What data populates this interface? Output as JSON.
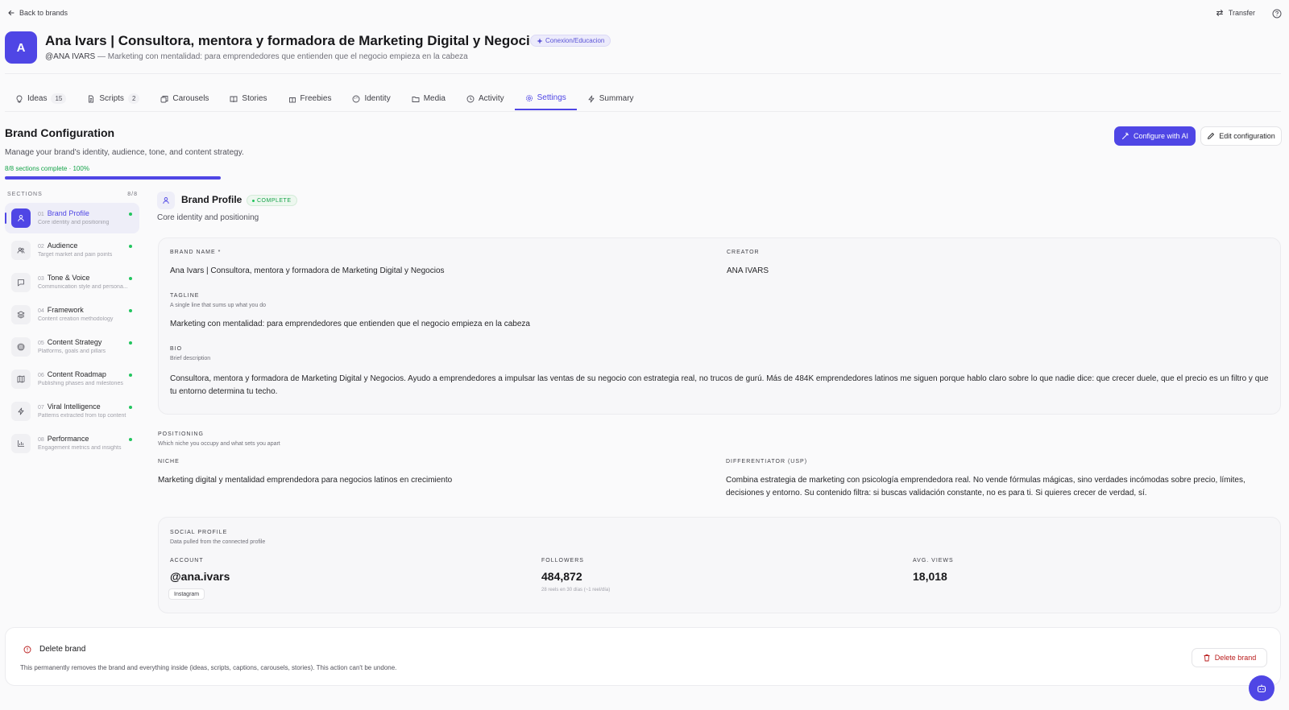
{
  "topbar": {
    "back_label": "Back to brands",
    "transfer_label": "Transfer"
  },
  "brand": {
    "avatar_letter": "A",
    "title": "Ana Ivars | Consultora, mentora y formadora de Marketing Digital y Negocios",
    "category": "Conexion/Educacion",
    "handle": "@ANA IVARS",
    "tagline_suffix": "— Marketing con mentalidad: para emprendedores que entienden que el negocio empieza en la cabeza"
  },
  "tabs": [
    {
      "label": "Ideas",
      "count": "15",
      "icon": "lightbulb-icon"
    },
    {
      "label": "Scripts",
      "count": "2",
      "icon": "document-icon"
    },
    {
      "label": "Carousels",
      "icon": "carousel-icon"
    },
    {
      "label": "Stories",
      "icon": "book-icon"
    },
    {
      "label": "Freebies",
      "icon": "gift-icon"
    },
    {
      "label": "Identity",
      "icon": "palette-icon"
    },
    {
      "label": "Media",
      "icon": "folder-icon"
    },
    {
      "label": "Activity",
      "icon": "clock-icon"
    },
    {
      "label": "Settings",
      "icon": "gear-icon",
      "active": true
    },
    {
      "label": "Summary",
      "icon": "bolt-icon"
    }
  ],
  "config": {
    "title": "Brand Configuration",
    "subtitle": "Manage your brand's identity, audience, tone, and content strategy.",
    "progress_text": "8/8 sections complete · 100%",
    "progress_fraction": 1.0,
    "configure_ai_label": "Configure with AI",
    "edit_label": "Edit configuration"
  },
  "sections": {
    "header": "SECTIONS",
    "count": "8/8",
    "items": [
      {
        "num": "01",
        "name": "Brand Profile",
        "desc": "Core identity and positioning",
        "icon": "user-icon",
        "active": true
      },
      {
        "num": "02",
        "name": "Audience",
        "desc": "Target market and pain points",
        "icon": "users-icon"
      },
      {
        "num": "03",
        "name": "Tone & Voice",
        "desc": "Communication style and persona...",
        "icon": "chat-icon"
      },
      {
        "num": "04",
        "name": "Framework",
        "desc": "Content creation methodology",
        "icon": "layers-icon"
      },
      {
        "num": "05",
        "name": "Content Strategy",
        "desc": "Platforms, goals and pillars",
        "icon": "target-icon"
      },
      {
        "num": "06",
        "name": "Content Roadmap",
        "desc": "Publishing phases and milestones",
        "icon": "map-icon"
      },
      {
        "num": "07",
        "name": "Viral Intelligence",
        "desc": "Patterns extracted from top content",
        "icon": "bolt-icon"
      },
      {
        "num": "08",
        "name": "Performance",
        "desc": "Engagement metrics and insights",
        "icon": "bar-chart-icon"
      }
    ]
  },
  "profile": {
    "title": "Brand Profile",
    "badge": "COMPLETE",
    "subtitle": "Core identity and positioning",
    "brand_name_label": "BRAND NAME *",
    "brand_name": "Ana Ivars | Consultora, mentora y formadora de Marketing Digital y Negocios",
    "creator_label": "CREATOR",
    "creator": "ANA IVARS",
    "tagline_label": "TAGLINE",
    "tagline_hint": "A single line that sums up what you do",
    "tagline": "Marketing con mentalidad: para emprendedores que entienden que el negocio empieza en la cabeza",
    "bio_label": "BIO",
    "bio_hint": "Brief description",
    "bio": "Consultora, mentora y formadora de Marketing Digital y Negocios. Ayudo a emprendedores a impulsar las ventas de su negocio con estrategia real, no trucos de gurú. Más de 484K emprendedores latinos me siguen porque hablo claro sobre lo que nadie dice: que crecer duele, que el precio es un filtro y que tu entorno determina tu techo."
  },
  "positioning": {
    "label": "POSITIONING",
    "hint": "Which niche you occupy and what sets you apart",
    "niche_label": "NICHE",
    "niche": "Marketing digital y mentalidad emprendedora para negocios latinos en crecimiento",
    "usp_label": "DIFFERENTIATOR (USP)",
    "usp": "Combina estrategia de marketing con psicología emprendedora real. No vende fórmulas mágicas, sino verdades incómodas sobre precio, límites, decisiones y entorno. Su contenido filtra: si buscas validación constante, no es para ti. Si quieres crecer de verdad, sí."
  },
  "social": {
    "label": "SOCIAL PROFILE",
    "hint": "Data pulled from the connected profile",
    "account_label": "ACCOUNT",
    "account": "@ana.ivars",
    "platform": "Instagram",
    "followers_label": "FOLLOWERS",
    "followers": "484,872",
    "followers_note": "28 reels en 30 días (~1 reel/día)",
    "views_label": "AVG. VIEWS",
    "views": "18,018"
  },
  "danger": {
    "title": "Delete brand",
    "description": "This permanently removes the brand and everything inside (ideas, scripts, captions, carousels, stories). This action can't be undone.",
    "button_label": "Delete brand"
  },
  "colors": {
    "accent": "#4f46e5",
    "success": "#22c55e",
    "danger": "#b91c1c"
  }
}
